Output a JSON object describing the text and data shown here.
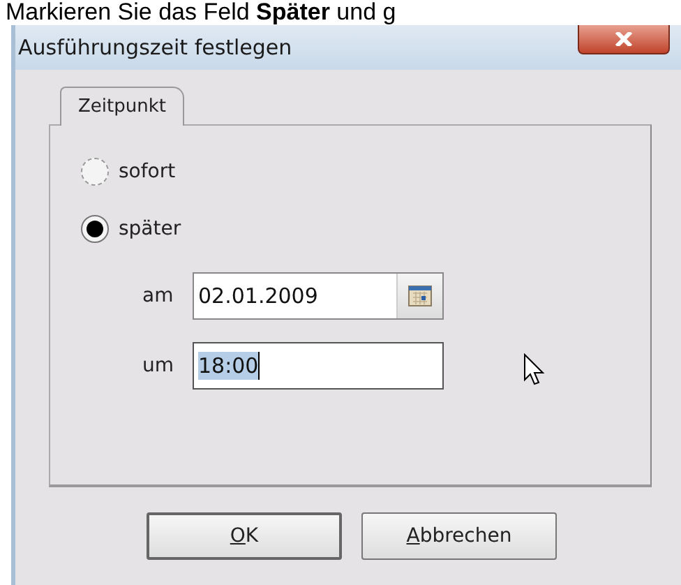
{
  "instruction": "Markieren Sie das Feld **Später** und g",
  "window": {
    "title": "Ausführungszeit festlegen"
  },
  "tabs": [
    {
      "label": "Zeitpunkt",
      "selected": true
    }
  ],
  "options": [
    {
      "label": "sofort",
      "selected": false
    },
    {
      "label": "später",
      "selected": true
    }
  ],
  "fields": [
    {
      "kind": "date",
      "label": "am",
      "value": "02.01.2009",
      "focused": false,
      "text_selected": false
    },
    {
      "kind": "text",
      "label": "um",
      "value": "18:00",
      "focused": true,
      "text_selected": true
    }
  ],
  "buttons": [
    {
      "label": "OK",
      "default": true,
      "mnemonic_underlined": true
    },
    {
      "label": "Abbrechen",
      "default": false,
      "mnemonic_underlined": true
    }
  ]
}
